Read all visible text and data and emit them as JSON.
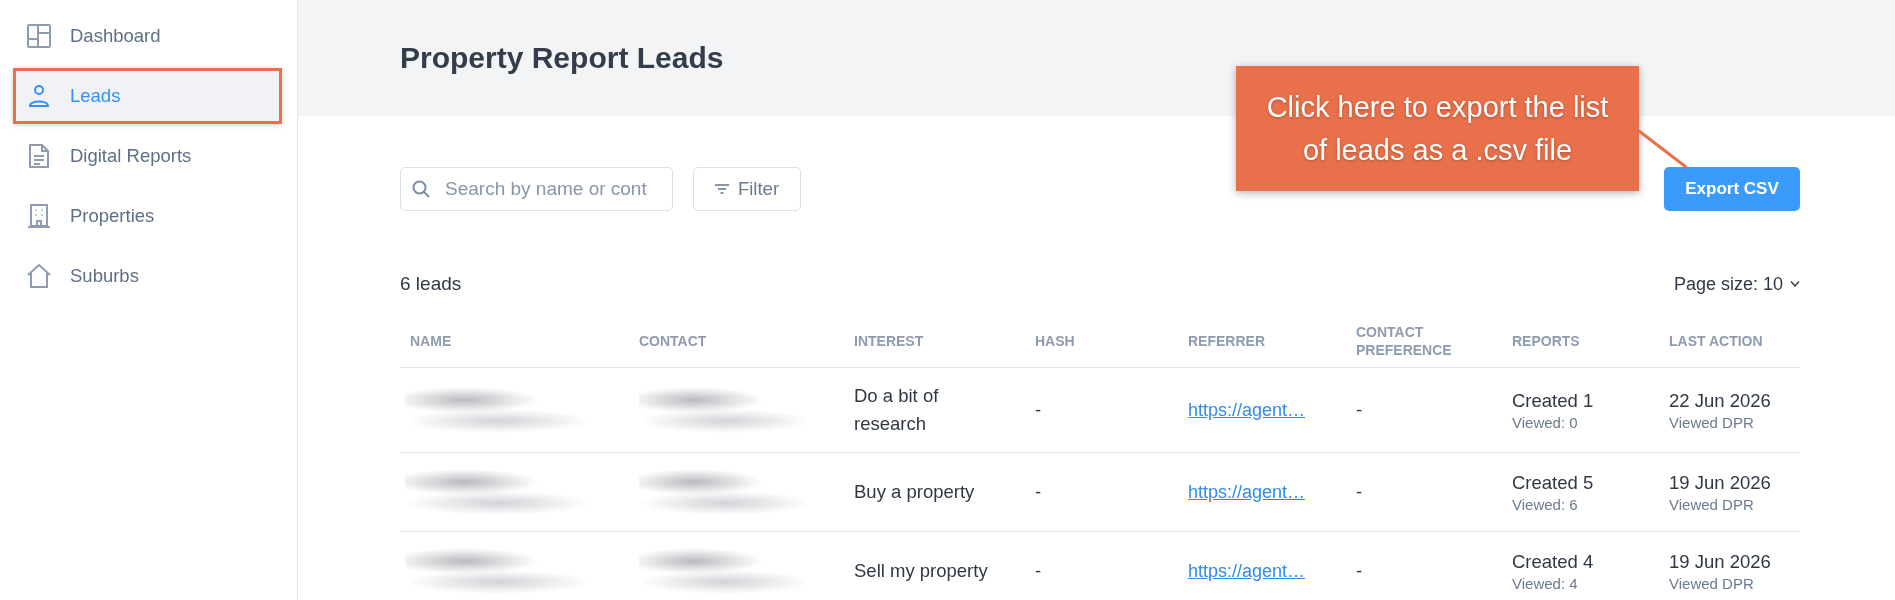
{
  "sidebar": {
    "items": [
      {
        "label": "Dashboard",
        "selected": false,
        "highlighted": false
      },
      {
        "label": "Leads",
        "selected": true,
        "highlighted": true
      },
      {
        "label": "Digital Reports",
        "selected": false,
        "highlighted": false
      },
      {
        "label": "Properties",
        "selected": false,
        "highlighted": false
      },
      {
        "label": "Suburbs",
        "selected": false,
        "highlighted": false
      }
    ]
  },
  "header": {
    "title": "Property Report Leads"
  },
  "toolbar": {
    "search": {
      "placeholder": "Search by name or cont"
    },
    "filter_button": "Filter",
    "export_button": "Export CSV"
  },
  "callout": {
    "text": "Click here to export the list of leads as a .csv file"
  },
  "summary": {
    "count": "6 leads",
    "page_size": "Page size: 10"
  },
  "table": {
    "columns": [
      "NAME",
      "CONTACT",
      "INTEREST",
      "HASH",
      "REFERRER",
      "CONTACT PREFERENCE",
      "REPORTS",
      "LAST ACTION"
    ],
    "rows": [
      {
        "name_redacted": true,
        "contact_redacted": true,
        "interest": "Do a bit of research",
        "hash": "-",
        "referrer": "https://agent…",
        "contact_preference": "-",
        "reports": "Created 1",
        "reports_viewed": "Viewed: 0",
        "last_action": "22 Jun 2026",
        "last_action_detail": "Viewed DPR"
      },
      {
        "name_redacted": true,
        "contact_redacted": true,
        "interest": "Buy a property",
        "hash": "-",
        "referrer": "https://agent…",
        "contact_preference": "-",
        "reports": "Created 5",
        "reports_viewed": "Viewed: 6",
        "last_action": "19 Jun 2026",
        "last_action_detail": "Viewed DPR"
      },
      {
        "name_redacted": true,
        "contact_redacted": true,
        "interest": "Sell my property",
        "hash": "-",
        "referrer": "https://agent…",
        "contact_preference": "-",
        "reports": "Created 4",
        "reports_viewed": "Viewed: 4",
        "last_action": "19 Jun 2026",
        "last_action_detail": "Viewed DPR"
      }
    ]
  }
}
